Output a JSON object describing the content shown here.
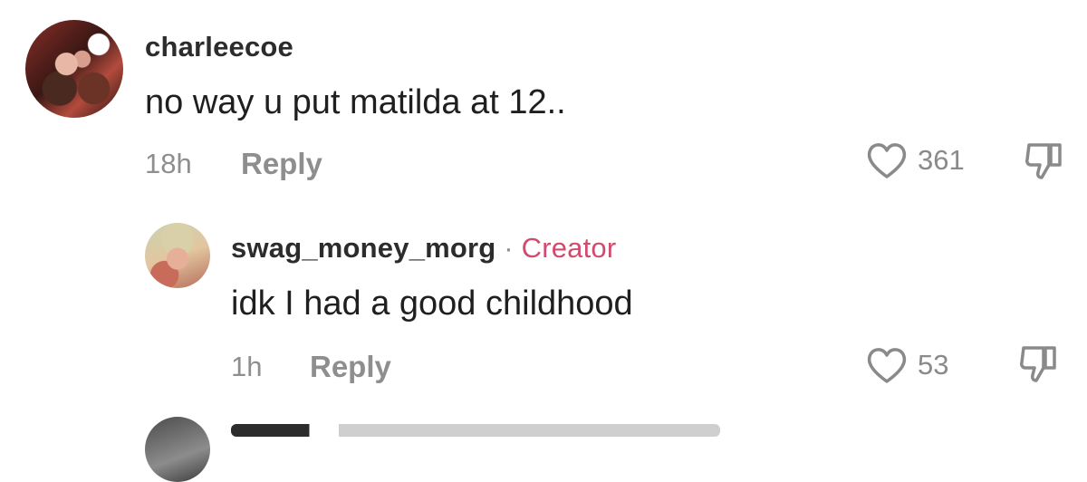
{
  "comments": [
    {
      "username": "charleecoe",
      "text": "no way u put matilda at 12..",
      "time": "18h",
      "reply_label": "Reply",
      "likes": "361"
    }
  ],
  "replies": [
    {
      "username": "swag_money_morg",
      "separator": "·",
      "badge": "Creator",
      "text": "idk I had a good childhood",
      "time": "1h",
      "reply_label": "Reply",
      "likes": "53"
    }
  ],
  "icons": {
    "like": "heart-outline-icon",
    "dislike": "thumbs-down-icon"
  },
  "colors": {
    "creator_badge": "#d14b6e",
    "meta_text": "#8e8e8e"
  }
}
